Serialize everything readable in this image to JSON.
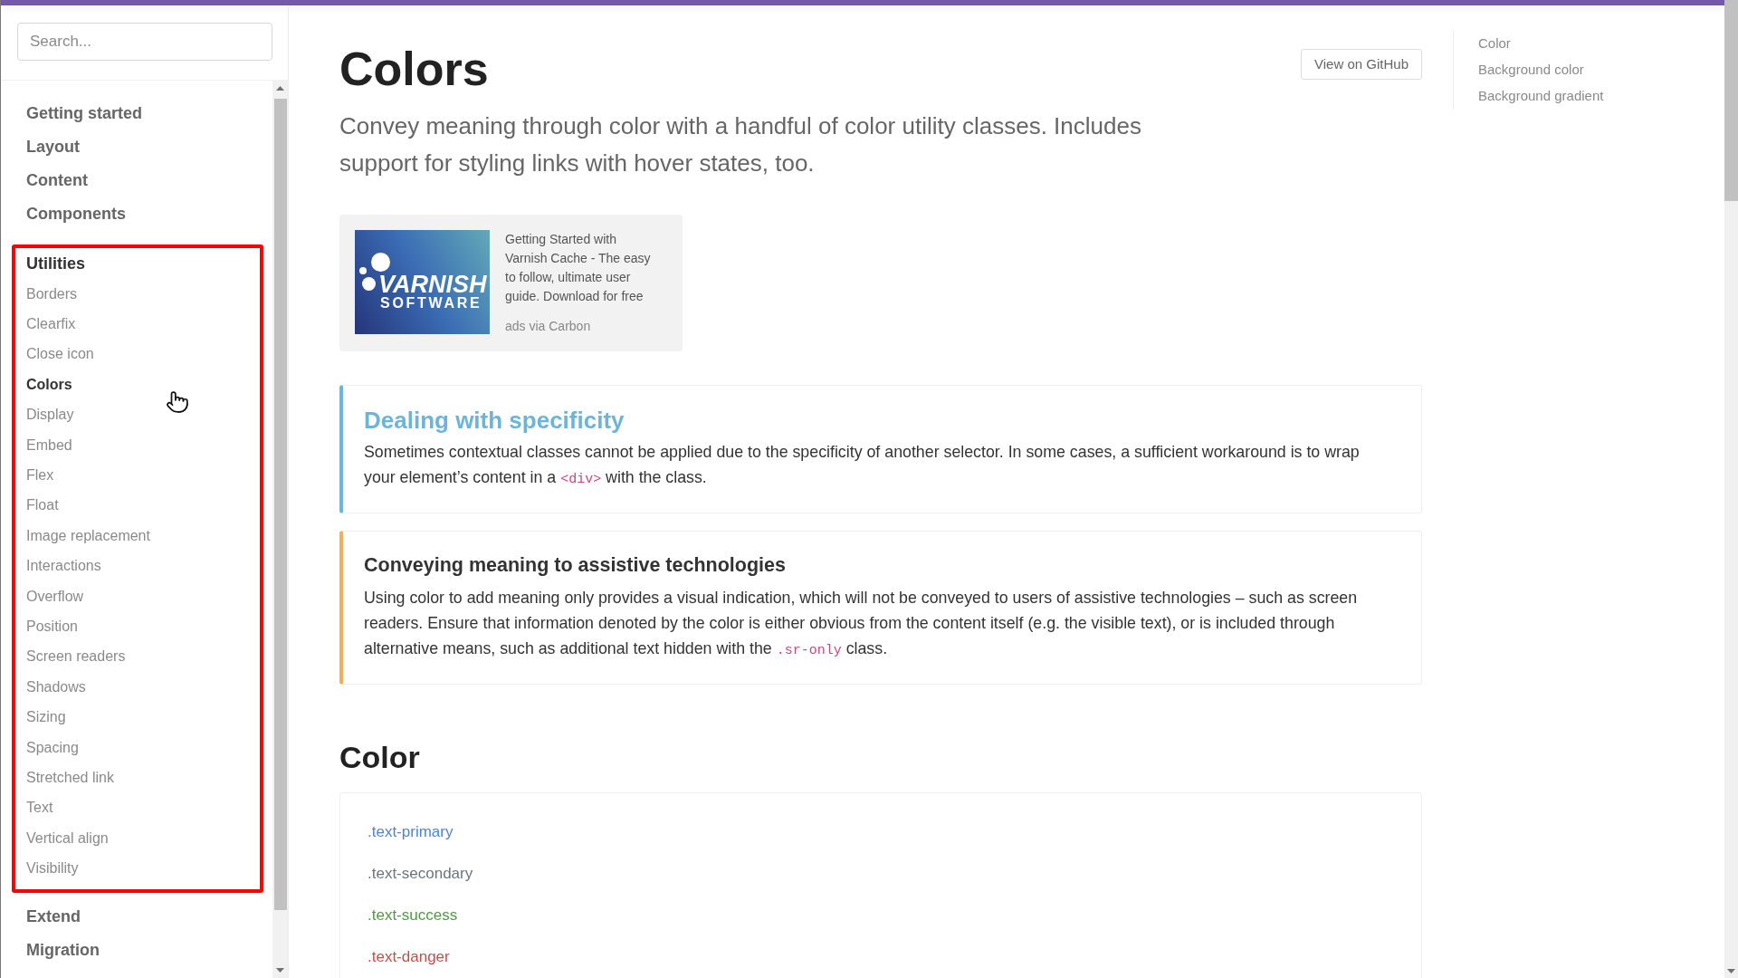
{
  "sidebar": {
    "search": {
      "placeholder": "Search..."
    },
    "sections": [
      {
        "label": "Getting started",
        "active": false,
        "highlighted": false
      },
      {
        "label": "Layout",
        "active": false,
        "highlighted": false
      },
      {
        "label": "Content",
        "active": false,
        "highlighted": false
      },
      {
        "label": "Components",
        "active": false,
        "highlighted": false
      },
      {
        "label": "Utilities",
        "active": true,
        "highlighted": true,
        "children": [
          {
            "label": "Borders",
            "selected": false
          },
          {
            "label": "Clearfix",
            "selected": false
          },
          {
            "label": "Close icon",
            "selected": false
          },
          {
            "label": "Colors",
            "selected": true
          },
          {
            "label": "Display",
            "selected": false
          },
          {
            "label": "Embed",
            "selected": false
          },
          {
            "label": "Flex",
            "selected": false
          },
          {
            "label": "Float",
            "selected": false
          },
          {
            "label": "Image replacement",
            "selected": false
          },
          {
            "label": "Interactions",
            "selected": false
          },
          {
            "label": "Overflow",
            "selected": false
          },
          {
            "label": "Position",
            "selected": false
          },
          {
            "label": "Screen readers",
            "selected": false
          },
          {
            "label": "Shadows",
            "selected": false
          },
          {
            "label": "Sizing",
            "selected": false
          },
          {
            "label": "Spacing",
            "selected": false
          },
          {
            "label": "Stretched link",
            "selected": false
          },
          {
            "label": "Text",
            "selected": false
          },
          {
            "label": "Vertical align",
            "selected": false
          },
          {
            "label": "Visibility",
            "selected": false
          }
        ]
      },
      {
        "label": "Extend",
        "active": false,
        "highlighted": false
      },
      {
        "label": "Migration",
        "active": false,
        "highlighted": false
      }
    ]
  },
  "page": {
    "title": "Colors",
    "github_button": "View on GitHub",
    "lead": "Convey meaning through color with a handful of color utility classes. Includes support for styling links with hover states, too."
  },
  "ad": {
    "image_title": "VARNISH",
    "image_subtitle": "SOFTWARE",
    "text": "Getting Started with Varnish Cache - The easy to follow, ultimate user guide. Download for free",
    "credit": "ads via Carbon"
  },
  "callouts": [
    {
      "kind": "info",
      "title": "Dealing with specificity",
      "body": [
        {
          "kind": "text",
          "text": "Sometimes contextual classes cannot be applied due to the specificity of another selector. In some cases, a sufficient workaround is to wrap your element’s content in a "
        },
        {
          "kind": "code",
          "text": "<div>"
        },
        {
          "kind": "text",
          "text": " with the class."
        }
      ]
    },
    {
      "kind": "warning",
      "title": "Conveying meaning to assistive technologies",
      "body": [
        {
          "kind": "text",
          "text": "Using color to add meaning only provides a visual indication, which will not be conveyed to users of assistive technologies – such as screen readers. Ensure that information denoted by the color is either obvious from the content itself (e.g. the visible text), or is included through alternative means, such as additional text hidden with the "
        },
        {
          "kind": "code",
          "text": ".sr-only"
        },
        {
          "kind": "text",
          "text": " class."
        }
      ]
    }
  ],
  "section": {
    "title": "Color",
    "examples": [
      {
        "label": ".text-primary",
        "color": "#4f84d4"
      },
      {
        "label": ".text-secondary",
        "color": "#6c757d"
      },
      {
        "label": ".text-success",
        "color": "#4e9a46"
      },
      {
        "label": ".text-danger",
        "color": "#c0504d"
      }
    ]
  },
  "toc": [
    {
      "label": "Color"
    },
    {
      "label": "Background color"
    },
    {
      "label": "Background gradient"
    }
  ]
}
